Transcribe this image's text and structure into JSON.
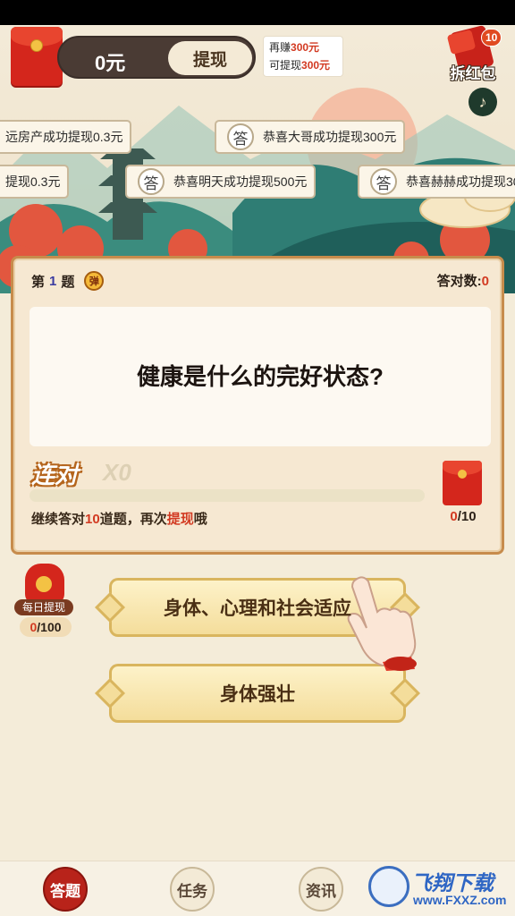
{
  "top": {
    "balance": "0元",
    "withdraw_label": "提现",
    "earn_line1_prefix": "再赚",
    "earn_line1_value": "300元",
    "earn_line2_prefix": "可提现",
    "earn_line2_value": "300元",
    "open_redpack_label": "拆红包",
    "open_redpack_badge": "10",
    "music_icon": "♪"
  },
  "notices": [
    {
      "text": "远房产成功提现0.3元",
      "icon": ""
    },
    {
      "text": "恭喜大哥成功提现300元",
      "icon": "答"
    },
    {
      "text": "提现0.3元",
      "icon": ""
    },
    {
      "text": "恭喜明天成功提现500元",
      "icon": "答"
    },
    {
      "text": "恭喜赫赫成功提现30",
      "icon": "答"
    }
  ],
  "question": {
    "index_prefix": "第",
    "index_number": "1",
    "index_suffix": "题",
    "bomb_icon": "弹",
    "correct_label": "答对数:",
    "correct_value": "0",
    "text": "健康是什么的完好状态?",
    "combo_label": "连对",
    "combo_value": "X0",
    "progress": 0,
    "hint_prefix": "继续答对",
    "hint_number": "10",
    "hint_middle": "道题，再次",
    "hint_highlight": "提现",
    "hint_suffix": "哦",
    "pack_current": "0",
    "pack_total": "/10"
  },
  "daily": {
    "label": "每日提现",
    "current": "0",
    "total": "/100"
  },
  "answers": [
    {
      "text": "身体、心理和社会适应"
    },
    {
      "text": "身体强壮"
    }
  ],
  "nav": [
    {
      "label": "答题",
      "active": true
    },
    {
      "label": "任务",
      "active": false
    },
    {
      "label": "资讯",
      "active": false
    }
  ],
  "watermark": {
    "brand": "飞翔下载",
    "url": "www.FXXZ.com"
  },
  "colors": {
    "accent_red": "#d4261c",
    "card_border": "#c78c4c",
    "answer_gold": "#f4dd9b",
    "background": "#f4ecd9"
  }
}
